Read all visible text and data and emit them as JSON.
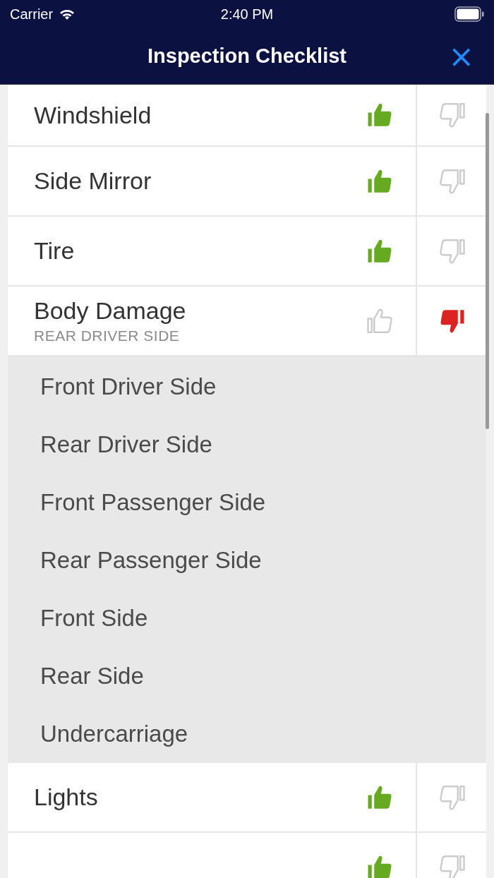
{
  "status_bar": {
    "carrier": "Carrier",
    "time": "2:40 PM"
  },
  "nav": {
    "title": "Inspection Checklist",
    "close": "×"
  },
  "items": [
    {
      "label": "Windshield",
      "thumbs_up": true,
      "thumbs_down": false
    },
    {
      "label": "Side Mirror",
      "thumbs_up": true,
      "thumbs_down": false
    },
    {
      "label": "Tire",
      "thumbs_up": true,
      "thumbs_down": false
    },
    {
      "label": "Body Damage",
      "subtitle": "REAR DRIVER SIDE",
      "thumbs_up": false,
      "thumbs_down": true,
      "expanded": true,
      "options": [
        "Front Driver Side",
        "Rear Driver Side",
        "Front Passenger Side",
        "Rear Passenger Side",
        "Front Side",
        "Rear Side",
        "Undercarriage"
      ]
    },
    {
      "label": "Lights",
      "thumbs_up": true,
      "thumbs_down": false
    },
    {
      "thumbs_up": true,
      "thumbs_down": false
    }
  ]
}
